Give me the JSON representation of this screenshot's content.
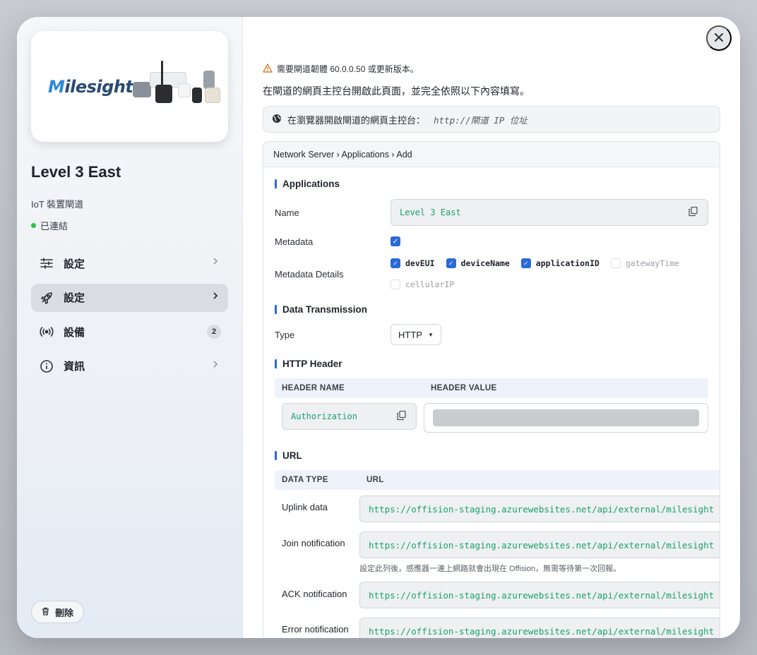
{
  "sidebar": {
    "brand_text": "Milesight",
    "device_title": "Level 3 East",
    "device_type": "IoT 裝置閘道",
    "status": "已連結",
    "nav": [
      {
        "label": "設定",
        "icon": "sliders-icon"
      },
      {
        "label": "設定",
        "icon": "rocket-icon"
      },
      {
        "label": "設備",
        "icon": "broadcast-icon",
        "badge": "2"
      },
      {
        "label": "資訊",
        "icon": "info-icon"
      }
    ],
    "delete_label": "刪除"
  },
  "main": {
    "warning": "需要閘道韌體 60.0.0.50 或更新版本。",
    "instruction": "在閘道的網頁主控台開啟此頁面，並完全依照以下內容填寫。",
    "open_console_label": "在瀏覽器開啟閘道的網頁主控台：",
    "console_url": "http://閘道 IP 位址",
    "breadcrumb": "Network Server › Applications › Add",
    "applications": {
      "heading": "Applications",
      "name_label": "Name",
      "name_value": "Level 3 East",
      "metadata_label": "Metadata",
      "metadata_details_label": "Metadata Details",
      "metadata_details": [
        {
          "name": "devEUI",
          "checked": true
        },
        {
          "name": "deviceName",
          "checked": true
        },
        {
          "name": "applicationID",
          "checked": true
        },
        {
          "name": "gatewayTime",
          "checked": false
        },
        {
          "name": "cellularIP",
          "checked": false
        }
      ]
    },
    "data_transmission": {
      "heading": "Data Transmission",
      "type_label": "Type",
      "type_value": "HTTP"
    },
    "http_header": {
      "heading": "HTTP Header",
      "col_name": "HEADER NAME",
      "col_value": "HEADER VALUE",
      "header_name": "Authorization"
    },
    "url": {
      "heading": "URL",
      "col_type": "DATA TYPE",
      "col_url": "URL",
      "rows": [
        {
          "type": "Uplink data",
          "url": "https://offision-staging.azurewebsites.net/api/external/milesight"
        },
        {
          "type": "Join notification",
          "url": "https://offision-staging.azurewebsites.net/api/external/milesight"
        },
        {
          "type": "ACK notification",
          "url": "https://offision-staging.azurewebsites.net/api/external/milesight"
        },
        {
          "type": "Error notification",
          "url": "https://offision-staging.azurewebsites.net/api/external/milesight"
        }
      ],
      "join_hint": "設定此列後，感應器一連上網路就會出現在 Offision，無需等待第一次回報。"
    }
  },
  "colors": {
    "accent": "#2a6ad8",
    "mono_value": "#1aa36a",
    "status_online": "#2fbf4a"
  }
}
